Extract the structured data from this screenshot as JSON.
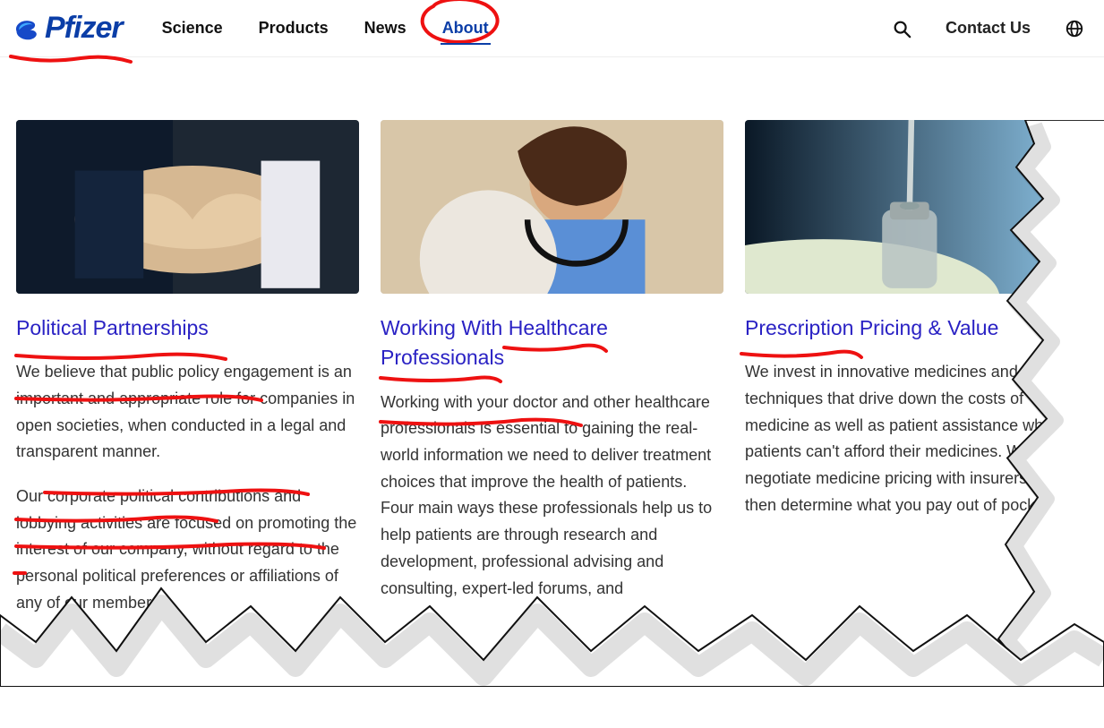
{
  "brand": {
    "name": "Pfizer"
  },
  "nav": {
    "items": [
      {
        "label": "Science",
        "active": false
      },
      {
        "label": "Products",
        "active": false
      },
      {
        "label": "News",
        "active": false
      },
      {
        "label": "About",
        "active": true
      }
    ],
    "contact": "Contact Us"
  },
  "cards": [
    {
      "title": "Political Partnerships",
      "body1": "We believe that public policy engagement is an important and appropriate role for companies in open societies, when conducted in a legal and transparent manner.",
      "body2": "Our corporate political contributions and lobbying activities are focused on promoting the interest of our company, without regard to the personal political preferences or affiliations of any of our members."
    },
    {
      "title": "Working With Healthcare Professionals",
      "body1": "Working with your doctor and other healthcare professionals is essential to gaining the real-world information we need to deliver treatment choices that improve the health of patients. Four main ways these professionals help us to help patients are through research and development, professional advising and consulting, expert-led forums, and",
      "body2": ""
    },
    {
      "title": "Prescription Pricing & Value",
      "body1": "We invest in innovative medicines and techniques that drive down the costs of medicine as well as patient assistance when patients can't afford their medicines. We negotiate medicine pricing with insurers who then determine what you pay out of pocket.",
      "body2": ""
    }
  ],
  "colors": {
    "accent": "#0b3ea7",
    "link": "#2a22c4",
    "annotation": "#e11"
  }
}
